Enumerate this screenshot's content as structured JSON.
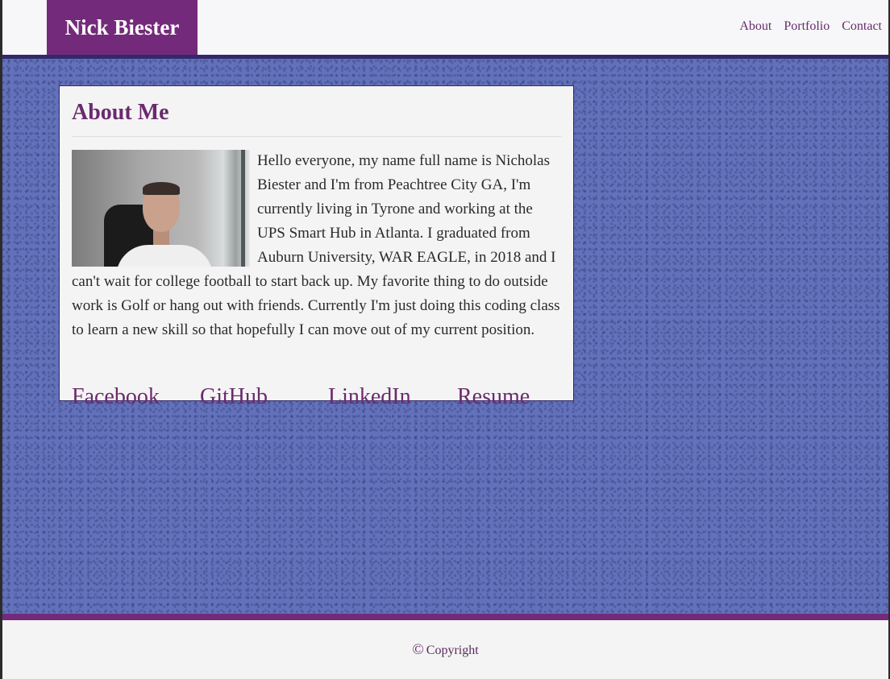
{
  "header": {
    "brand": "Nick Biester",
    "nav": [
      {
        "label": "About"
      },
      {
        "label": "Portfolio"
      },
      {
        "label": "Contact"
      }
    ]
  },
  "about": {
    "title": "About Me",
    "bio": "Hello everyone, my name full name is Nicholas Biester and I'm from Peachtree City GA, I'm currently living in Tyrone and working at the UPS Smart Hub in Atlanta. I graduated from Auburn University, WAR EAGLE, in 2018 and I can't wait for college football to start back up. My favorite thing to do outside work is Golf or hang out with friends. Currently I'm just doing this coding class to learn a new skill so that hopefully I can move out of my current position.",
    "links": [
      {
        "label": "Facebook"
      },
      {
        "label": "GitHub"
      },
      {
        "label": "LinkedIn"
      },
      {
        "label": "Resume"
      }
    ]
  },
  "footer": {
    "copyright_icon": "©",
    "copyright_text": "Copyright"
  },
  "colors": {
    "brand_purple": "#742a7a",
    "text_purple": "#6a2a6e",
    "header_rule": "#32286b",
    "background_blue": "#6271b9"
  }
}
